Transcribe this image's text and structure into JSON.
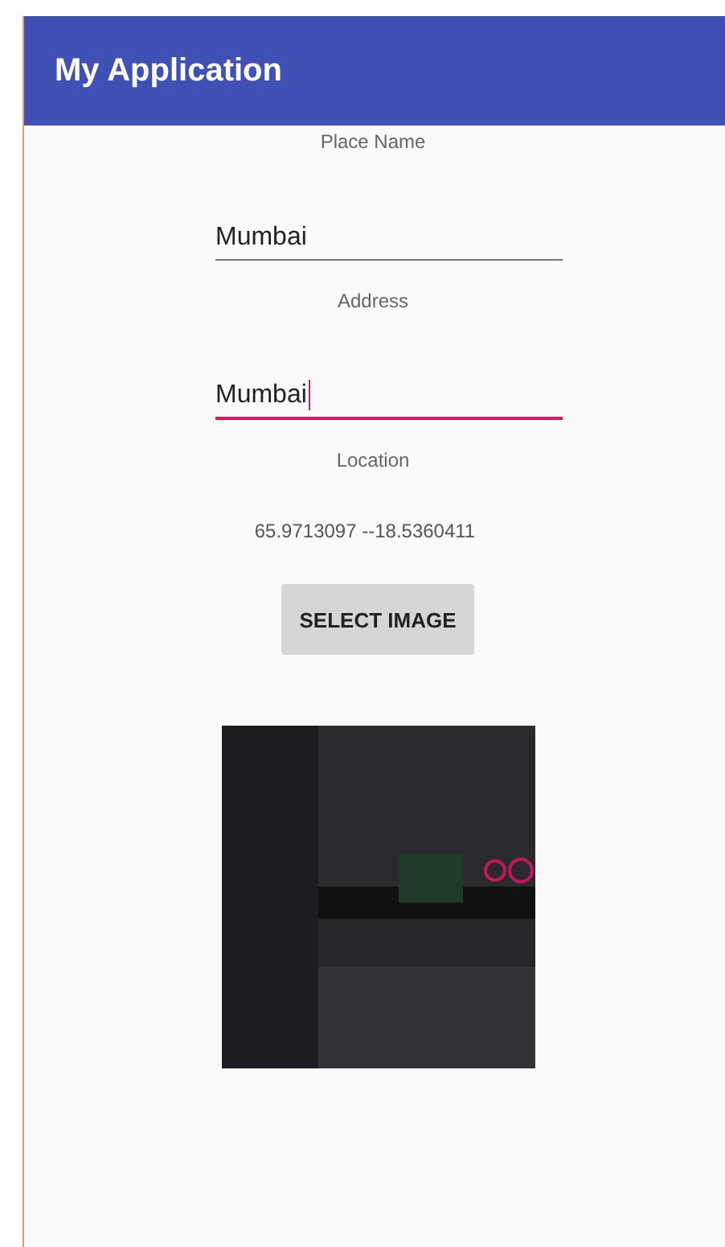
{
  "app_bar": {
    "title": "My Application"
  },
  "form": [
    {
      "kind": "label",
      "text": "Place Name"
    },
    {
      "kind": "field",
      "value": "Mumbai",
      "focused": false
    },
    {
      "kind": "label",
      "text": "Address"
    },
    {
      "kind": "field",
      "value": "Mumbai",
      "focused": true
    },
    {
      "kind": "label",
      "text": "Location"
    },
    {
      "kind": "coordinates",
      "text": "65.9713097 --18.5360411"
    },
    {
      "kind": "button",
      "text": "SELECT IMAGE"
    },
    {
      "kind": "picture"
    }
  ]
}
